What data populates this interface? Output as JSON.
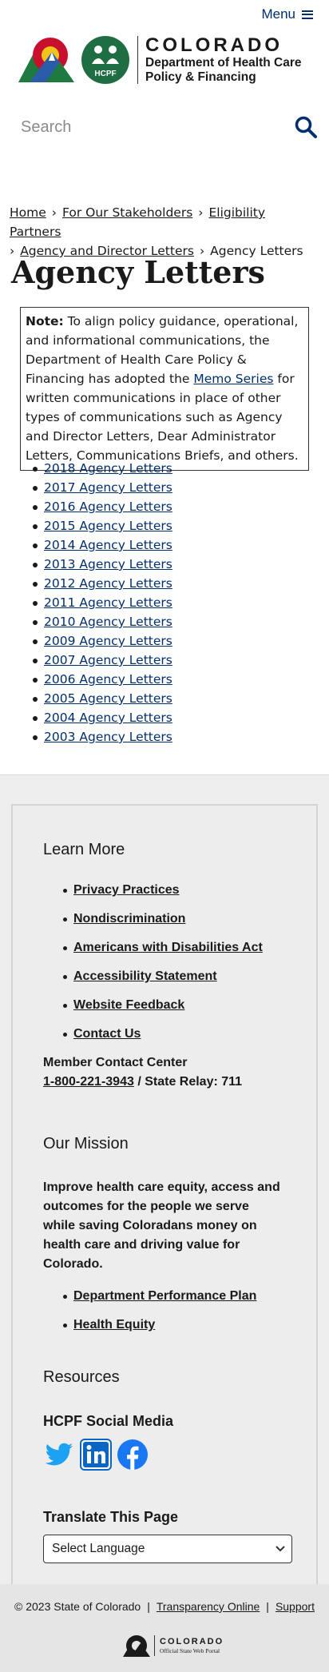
{
  "header": {
    "menu_label": "Menu",
    "logo_state": "COLORADO",
    "logo_dept_line1": "Department of Health Care",
    "logo_dept_line2": "Policy & Financing",
    "hcpf_badge": "HCPF"
  },
  "search": {
    "placeholder": "Search"
  },
  "breadcrumb": {
    "items": [
      "Home",
      "For Our Stakeholders",
      "Eligibility Partners",
      "Agency and Director Letters"
    ],
    "current": "Agency Letters"
  },
  "page_title": "Agency Letters",
  "note": {
    "label": "Note:",
    "text_before": " To align policy guidance, operational, and informational communications, the Department of Health Care Policy & Financing has adopted the ",
    "link": "Memo Series",
    "text_after": " for written communications in place of other types of communications such as Agency and Director Letters, Dear Administrator Letters, Communications Briefs, and others."
  },
  "letters": [
    "2018 Agency Letters",
    "2017 Agency Letters",
    "2016 Agency Letters",
    "2015 Agency Letters",
    "2014 Agency Letters",
    "2013 Agency Letters",
    "2012 Agency Letters",
    "2011 Agency Letters",
    "2010 Agency Letters",
    "2009 Agency Letters",
    "2007 Agency Letters",
    "2006 Agency Letters",
    "2005 Agency Letters",
    "2004 Agency Letters",
    "2003 Agency Letters"
  ],
  "footer": {
    "learn_more": {
      "heading": "Learn More",
      "links": [
        "Privacy Practices",
        "Nondiscrimination",
        "Americans with Disabilities Act",
        "Accessibility Statement",
        "Website Feedback",
        "Contact Us"
      ]
    },
    "contact": {
      "label": "Member Contact Center",
      "phone": "1-800-221-3943",
      "relay": " / State Relay: 711"
    },
    "mission": {
      "heading": "Our Mission",
      "text": "Improve health care equity, access and outcomes for the people we serve while saving Coloradans money on health care and driving value for Colorado.",
      "links": [
        "Department Performance Plan",
        "Health Equity"
      ]
    },
    "resources": {
      "heading": "Resources"
    },
    "social": {
      "heading": "HCPF Social Media",
      "icons": [
        "twitter-icon",
        "linkedin-icon",
        "facebook-icon"
      ]
    },
    "translate": {
      "heading": "Translate This Page",
      "select_value": "Select Language"
    }
  },
  "bottom": {
    "copyright": "© 2023 State of Colorado",
    "links": [
      "Transparency Online",
      "Support"
    ],
    "portal_name": "COLORADO",
    "portal_sub": "Official State Web Portal"
  },
  "colors": {
    "link": "#002f6c",
    "footer_bg": "#eeeeee",
    "bottom_bg": "#e5e5e5",
    "twitter": "#1da1f2",
    "linkedin": "#0a66c2",
    "facebook": "#1877f2"
  }
}
